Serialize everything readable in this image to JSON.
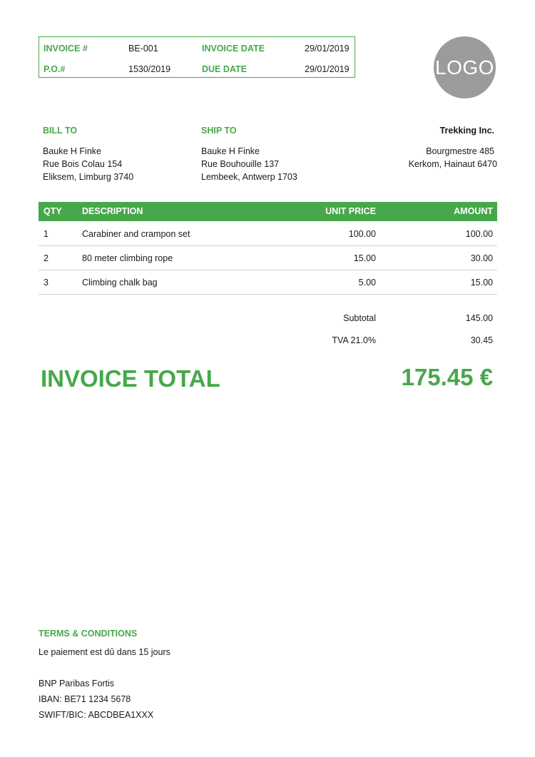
{
  "meta": {
    "invoice_no_label": "INVOICE #",
    "invoice_no": "BE-001",
    "invoice_date_label": "INVOICE DATE",
    "invoice_date": "29/01/2019",
    "po_label": "P.O.#",
    "po": "1530/2019",
    "due_date_label": "DUE DATE",
    "due_date": "29/01/2019"
  },
  "logo": {
    "text": "LOGO"
  },
  "bill_to": {
    "label": "BILL TO",
    "name": "Bauke H Finke",
    "street": "Rue Bois Colau 154",
    "city": "Eliksem, Limburg 3740"
  },
  "ship_to": {
    "label": "SHIP TO",
    "name": "Bauke H Finke",
    "street": "Rue Bouhouille 137",
    "city": "Lembeek, Antwerp 1703"
  },
  "company": {
    "name": "Trekking Inc.",
    "street": "Bourgmestre 485",
    "city": "Kerkom, Hainaut 6470"
  },
  "table": {
    "headers": {
      "qty": "QTY",
      "description": "DESCRIPTION",
      "unit_price": "UNIT PRICE",
      "amount": "AMOUNT"
    },
    "rows": [
      {
        "qty": "1",
        "description": "Carabiner and crampon set",
        "unit_price": "100.00",
        "amount": "100.00"
      },
      {
        "qty": "2",
        "description": "80 meter climbing rope",
        "unit_price": "15.00",
        "amount": "30.00"
      },
      {
        "qty": "3",
        "description": "Climbing chalk bag",
        "unit_price": "5.00",
        "amount": "15.00"
      }
    ]
  },
  "totals": {
    "subtotal_label": "Subtotal",
    "subtotal": "145.00",
    "tax_label": "TVA 21.0%",
    "tax": "30.45",
    "total_label": "INVOICE TOTAL",
    "total": "175.45 €"
  },
  "terms": {
    "heading": "TERMS & CONDITIONS",
    "text": "Le paiement est dû dans 15 jours",
    "bank": "BNP Paribas Fortis",
    "iban": "IBAN: BE71 1234 5678",
    "swift": "SWIFT/BIC: ABCDBEA1XXX"
  },
  "colors": {
    "accent": "#46a84a",
    "logo_bg": "#9b9b9b",
    "row_divider": "#d4d4d4"
  }
}
